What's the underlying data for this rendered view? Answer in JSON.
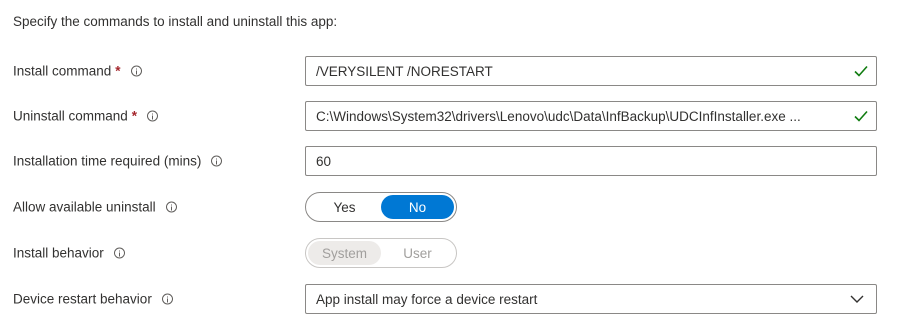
{
  "intro_text": "Specify the commands to install and uninstall this app:",
  "install_command": {
    "label": "Install command",
    "required_mark": "*",
    "value": "/VERYSILENT /NORESTART"
  },
  "uninstall_command": {
    "label": "Uninstall command",
    "required_mark": "*",
    "value": "C:\\Windows\\System32\\drivers\\Lenovo\\udc\\Data\\InfBackup\\UDCInfInstaller.exe ..."
  },
  "installation_time": {
    "label": "Installation time required (mins)",
    "value": "60"
  },
  "allow_uninstall": {
    "label": "Allow available uninstall",
    "options": [
      "Yes",
      "No"
    ],
    "selected": "No"
  },
  "install_behavior": {
    "label": "Install behavior",
    "options": [
      "System",
      "User"
    ],
    "selected": "System",
    "disabled": true
  },
  "device_restart": {
    "label": "Device restart behavior",
    "value": "App install may force a device restart"
  },
  "colors": {
    "accent": "#0078d4",
    "valid_check": "#107c10",
    "required": "#a4262c"
  },
  "icons": {
    "info": "info-icon",
    "valid": "checkmark-icon",
    "dropdown": "chevron-down-icon"
  }
}
